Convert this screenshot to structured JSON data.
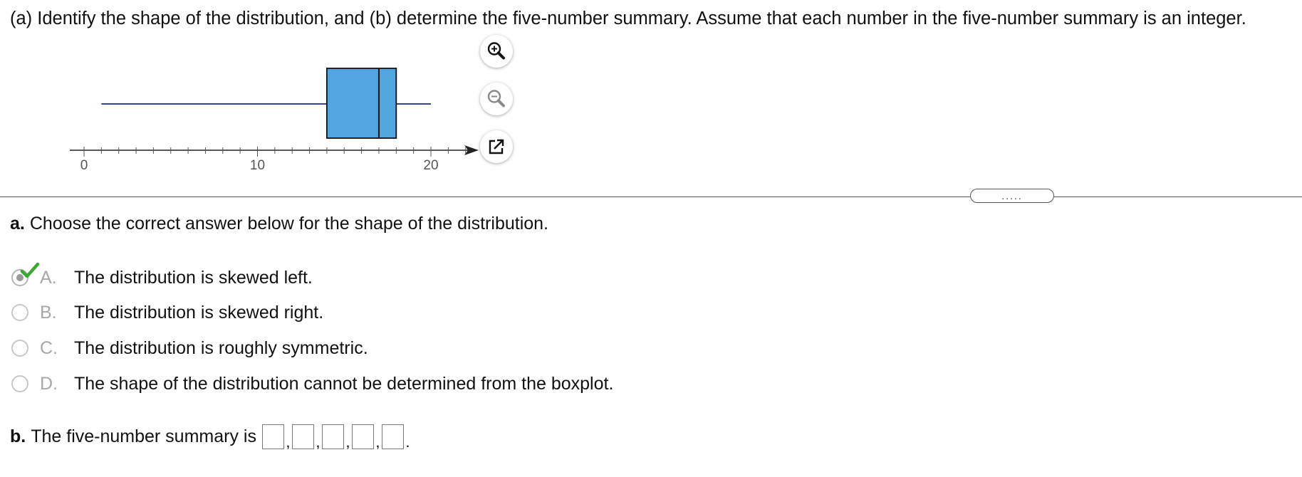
{
  "question": {
    "text": "(a) Identify the shape of the distribution, and (b) determine the five-number summary. Assume that each number in the five-number summary is an integer."
  },
  "toolbar": {
    "zoom_in_icon": "zoom-in-icon",
    "zoom_out_icon": "zoom-out-icon",
    "popout_icon": "external-link-icon"
  },
  "chart_data": {
    "type": "boxplot",
    "min": 1,
    "q1": 14,
    "median": 17,
    "q3": 18,
    "max": 20,
    "xlim": [
      0,
      22
    ],
    "major_ticks": [
      "0",
      "10",
      "20"
    ],
    "minor_tick_step": 1,
    "box_color": "#52a6e0",
    "line_color": "#1a2a8a"
  },
  "divider": {
    "handle_label": "....."
  },
  "part_a": {
    "label": "a.",
    "prompt": "Choose the correct answer below for the shape of the distribution.",
    "options": [
      {
        "letter": "A.",
        "text": "The distribution is skewed left.",
        "selected": true,
        "correct": true
      },
      {
        "letter": "B.",
        "text": "The distribution is skewed right.",
        "selected": false
      },
      {
        "letter": "C.",
        "text": "The distribution is roughly symmetric.",
        "selected": false
      },
      {
        "letter": "D.",
        "text": "The shape of the distribution cannot be determined from the boxplot.",
        "selected": false
      }
    ]
  },
  "part_b": {
    "label": "b.",
    "prompt": "The five-number summary is",
    "values": [
      "",
      "",
      "",
      "",
      ""
    ],
    "separator": ",",
    "terminator": "."
  },
  "colors": {
    "accent_check": "#3aa832",
    "option_letter": "#a8a8a8"
  }
}
